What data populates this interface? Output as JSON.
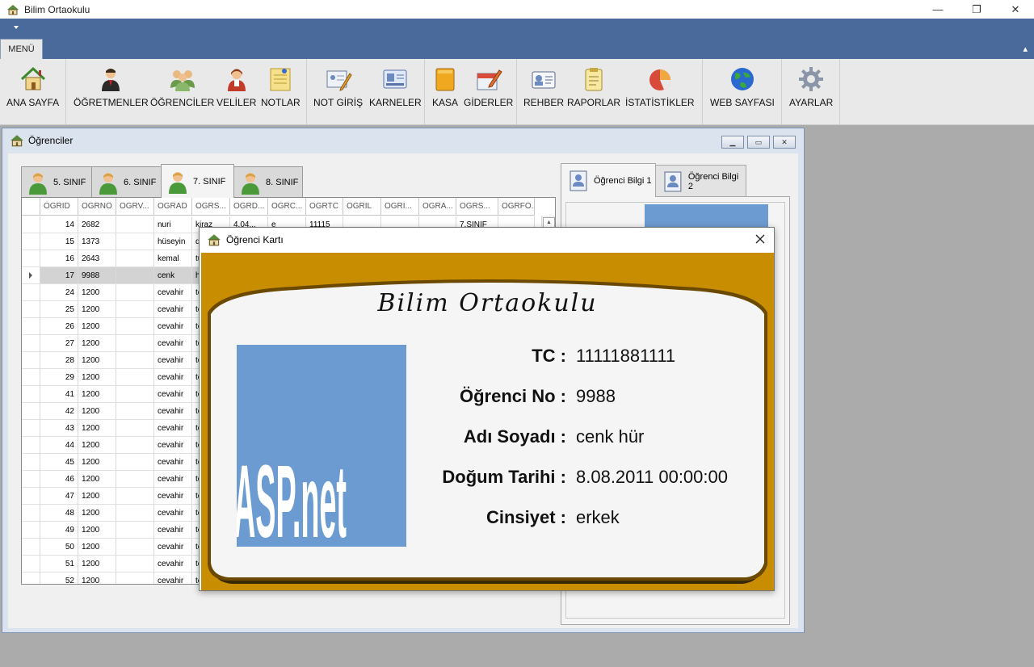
{
  "app": {
    "title": "Bilim Ortaokulu"
  },
  "menu_tab": "MENÜ",
  "ribbon": [
    {
      "label": "ANA SAYFA",
      "icon": "home-icon"
    },
    {
      "label": "ÖĞRETMENLER",
      "icon": "teacher-icon"
    },
    {
      "label": "ÖĞRENCİLER",
      "icon": "students-icon"
    },
    {
      "label": "VELİLER",
      "icon": "parent-icon"
    },
    {
      "label": "NOTLAR",
      "icon": "notes-icon"
    },
    {
      "label": "NOT GİRİŞ",
      "icon": "grade-entry-icon"
    },
    {
      "label": "KARNELER",
      "icon": "report-card-icon"
    },
    {
      "label": "KASA",
      "icon": "safe-icon"
    },
    {
      "label": "GİDERLER",
      "icon": "expenses-icon"
    },
    {
      "label": "REHBER",
      "icon": "contacts-icon"
    },
    {
      "label": "RAPORLAR",
      "icon": "reports-icon"
    },
    {
      "label": "İSTATİSTİKLER",
      "icon": "pie-chart-icon"
    },
    {
      "label": "WEB SAYFASI",
      "icon": "globe-icon"
    },
    {
      "label": "AYARLAR",
      "icon": "gear-icon"
    }
  ],
  "students_window": {
    "title": "Öğrenciler",
    "class_tabs": [
      "5. SINIF",
      "6. SINIF",
      "7. SINIF",
      "8. SINIF"
    ],
    "selected_class_tab": "7. SINIF",
    "columns": [
      "OGRID",
      "OGRNO",
      "OGRV...",
      "OGRAD",
      "OGRS...",
      "OGRD...",
      "OGRC...",
      "OGRTC",
      "OGRIL",
      "OGRI...",
      "OGRA...",
      "OGRS...",
      "OGRFO..."
    ],
    "rows": [
      [
        "14",
        "2682",
        "",
        "nuri",
        "kiraz",
        "4.04...",
        "e",
        "11115",
        "",
        "",
        "",
        "7.SINIF",
        ""
      ],
      [
        "15",
        "1373",
        "",
        "hüseyin",
        "di",
        "",
        "",
        "",
        "",
        "",
        "",
        "",
        ""
      ],
      [
        "16",
        "2643",
        "",
        "kemal",
        "tu",
        "",
        "",
        "",
        "",
        "",
        "",
        "",
        ""
      ],
      [
        "17",
        "9988",
        "",
        "cenk",
        "hü",
        "",
        "",
        "",
        "",
        "",
        "",
        "",
        ""
      ],
      [
        "24",
        "1200",
        "",
        "cevahir",
        "te",
        "",
        "",
        "",
        "",
        "",
        "",
        "",
        ""
      ],
      [
        "25",
        "1200",
        "",
        "cevahir",
        "te",
        "",
        "",
        "",
        "",
        "",
        "",
        "",
        ""
      ],
      [
        "26",
        "1200",
        "",
        "cevahir",
        "te",
        "",
        "",
        "",
        "",
        "",
        "",
        "",
        ""
      ],
      [
        "27",
        "1200",
        "",
        "cevahir",
        "te",
        "",
        "",
        "",
        "",
        "",
        "",
        "",
        ""
      ],
      [
        "28",
        "1200",
        "",
        "cevahir",
        "te",
        "",
        "",
        "",
        "",
        "",
        "",
        "",
        ""
      ],
      [
        "29",
        "1200",
        "",
        "cevahir",
        "te",
        "",
        "",
        "",
        "",
        "",
        "",
        "",
        ""
      ],
      [
        "41",
        "1200",
        "",
        "cevahir",
        "te",
        "",
        "",
        "",
        "",
        "",
        "",
        "",
        ""
      ],
      [
        "42",
        "1200",
        "",
        "cevahir",
        "te",
        "",
        "",
        "",
        "",
        "",
        "",
        "",
        ""
      ],
      [
        "43",
        "1200",
        "",
        "cevahir",
        "te",
        "",
        "",
        "",
        "",
        "",
        "",
        "",
        ""
      ],
      [
        "44",
        "1200",
        "",
        "cevahir",
        "te",
        "",
        "",
        "",
        "",
        "",
        "",
        "",
        ""
      ],
      [
        "45",
        "1200",
        "",
        "cevahir",
        "te",
        "",
        "",
        "",
        "",
        "",
        "",
        "",
        ""
      ],
      [
        "46",
        "1200",
        "",
        "cevahir",
        "te",
        "",
        "",
        "",
        "",
        "",
        "",
        "",
        ""
      ],
      [
        "47",
        "1200",
        "",
        "cevahir",
        "te",
        "",
        "",
        "",
        "",
        "",
        "",
        "",
        ""
      ],
      [
        "48",
        "1200",
        "",
        "cevahir",
        "te",
        "",
        "",
        "",
        "",
        "",
        "",
        "",
        ""
      ],
      [
        "49",
        "1200",
        "",
        "cevahir",
        "te",
        "",
        "",
        "",
        "",
        "",
        "",
        "",
        ""
      ],
      [
        "50",
        "1200",
        "",
        "cevahir",
        "te",
        "",
        "",
        "",
        "",
        "",
        "",
        "",
        ""
      ],
      [
        "51",
        "1200",
        "",
        "cevahir",
        "te",
        "",
        "",
        "",
        "",
        "",
        "",
        "",
        ""
      ],
      [
        "52",
        "1200",
        "",
        "cevahir",
        "te",
        "",
        "",
        "",
        "",
        "",
        "",
        "",
        ""
      ]
    ],
    "selected_row": 3,
    "info_tabs": [
      "Öğrenci Bilgi 1",
      "Öğrenci Bilgi 2"
    ]
  },
  "student_card": {
    "title": "Öğrenci Kartı",
    "school": "Bilim Ortaokulu",
    "photo_text": "ASP.net",
    "fields": [
      {
        "label": "TC :",
        "value": "11111881111"
      },
      {
        "label": "Öğrenci No :",
        "value": "9988"
      },
      {
        "label": "Adı Soyadı :",
        "value": "cenk hür"
      },
      {
        "label": "Doğum Tarihi :",
        "value": "8.08.2011 00:00:00"
      },
      {
        "label": "Cinsiyet :",
        "value": "erkek"
      }
    ]
  },
  "colors": {
    "ribbon_blue": "#4a6a9c",
    "card_gold": "#c88d00",
    "photo_blue": "#6b9bd0"
  }
}
